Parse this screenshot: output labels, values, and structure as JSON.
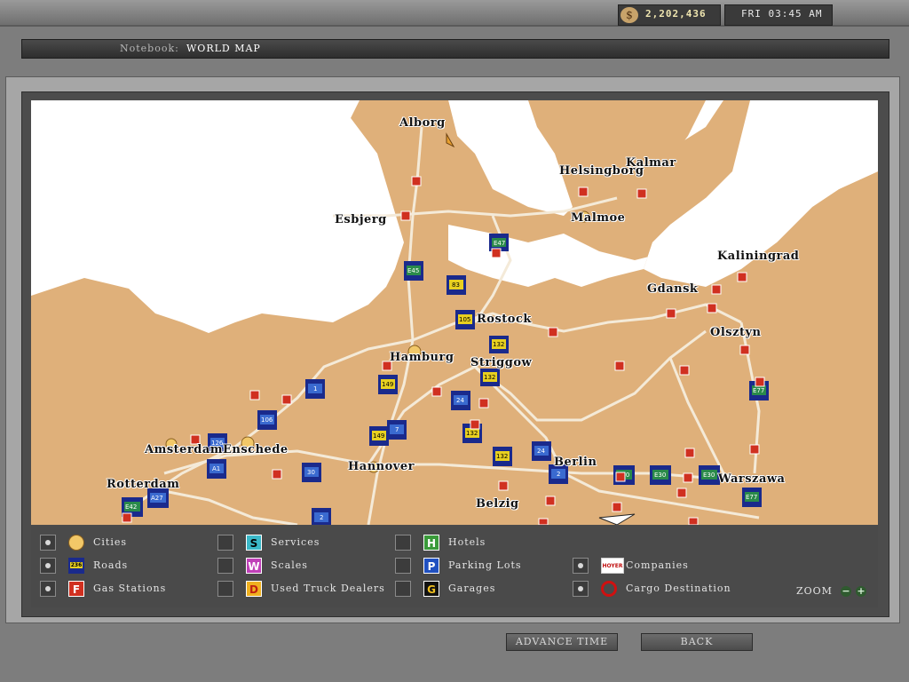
{
  "hud": {
    "money": "2,202,436",
    "clock": "FRI 03:45 AM"
  },
  "notebook": {
    "label": "Notebook:",
    "title": "WORLD MAP"
  },
  "cities": [
    "Alborg",
    "Helsingborg",
    "Kalmar",
    "Esbjerg",
    "Malmoe",
    "Kaliningrad",
    "Gdansk",
    "Rostock",
    "Olsztyn",
    "Hamburg",
    "Striggow",
    "Amsterdam",
    "Enschede",
    "Hannover",
    "Berlin",
    "Rotterdam",
    "Warszawa",
    "Belzig"
  ],
  "road_badges": [
    "E47",
    "E45",
    "83",
    "105",
    "132",
    "132",
    "149",
    "1",
    "24",
    "106",
    "126",
    "149",
    "7",
    "132",
    "132",
    "A1",
    "30",
    "24",
    "2",
    "E30",
    "E30",
    "E30",
    "E77",
    "E77",
    "A27",
    "E42",
    "2"
  ],
  "legend": {
    "cities": "Cities",
    "roads": "Roads",
    "roads_icon": "236",
    "gas": "Gas Stations",
    "gas_icon": "F",
    "services": "Services",
    "services_icon": "S",
    "scales": "Scales",
    "scales_icon": "W",
    "dealers": "Used Truck Dealers",
    "dealers_icon": "D",
    "hotels": "Hotels",
    "hotels_icon": "H",
    "parking": "Parking Lots",
    "parking_icon": "P",
    "garages": "Garages",
    "garages_icon": "G",
    "companies": "Companies",
    "companies_icon": "HOYER",
    "cargo": "Cargo Destination"
  },
  "zoom": {
    "label": "ZOOM",
    "minus": "−",
    "plus": "+"
  },
  "buttons": {
    "advance": "ADVANCE TIME",
    "back": "BACK"
  },
  "colors": {
    "land": "#dfb07a",
    "water": "#ffffff",
    "road": "#f2e6d2",
    "badge_blue": "#1a2a8c",
    "gas_red": "#d03020"
  }
}
